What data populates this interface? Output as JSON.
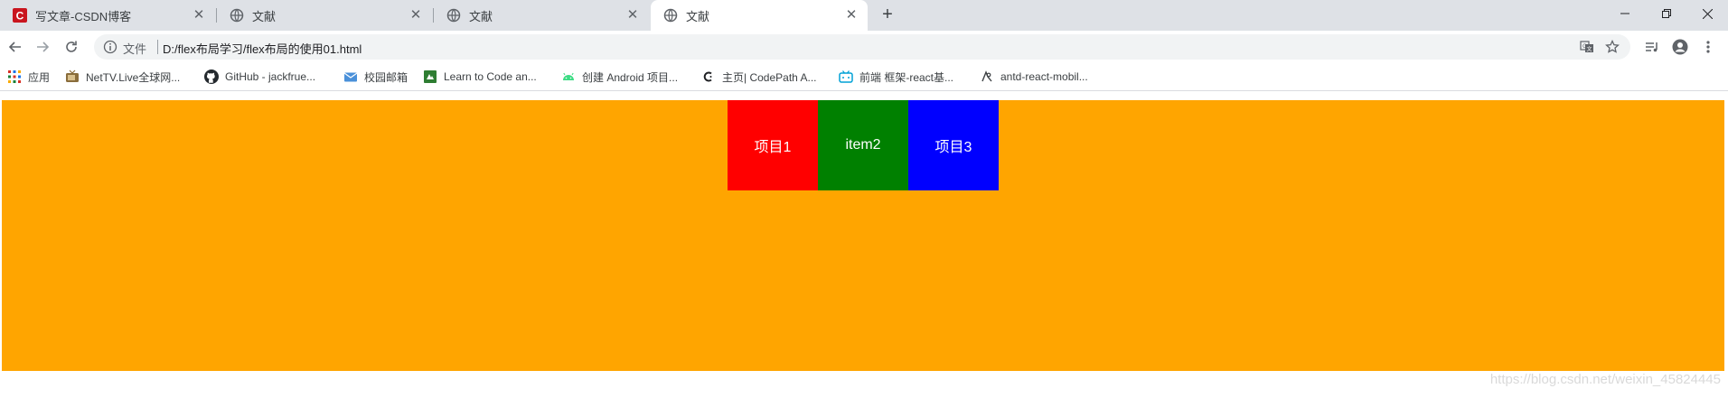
{
  "tabs": [
    {
      "title": "写文章-CSDN博客",
      "icon": "csdn-logo-icon",
      "active": false
    },
    {
      "title": "文献",
      "icon": "globe-icon",
      "active": false
    },
    {
      "title": "文献",
      "icon": "globe-icon",
      "active": false
    },
    {
      "title": "文献",
      "icon": "globe-icon",
      "active": true
    }
  ],
  "toolbar": {
    "scheme_label": "文件",
    "url": "D:/flex布局学习/flex布局的使用01.html"
  },
  "bookmarks": [
    {
      "label": "应用",
      "icon": "apps-grid-icon"
    },
    {
      "label": "NetTV.Live全球网...",
      "icon": "tv-icon"
    },
    {
      "label": "GitHub - jackfrue...",
      "icon": "github-icon"
    },
    {
      "label": "校园邮箱",
      "icon": "mail-icon"
    },
    {
      "label": "Learn to Code an...",
      "icon": "freecodecamp-icon"
    },
    {
      "label": "创建 Android 项目...",
      "icon": "android-icon"
    },
    {
      "label": "主页| CodePath A...",
      "icon": "codepath-icon"
    },
    {
      "label": "前端 框架-react基...",
      "icon": "bilibili-icon"
    },
    {
      "label": "antd-react-mobil...",
      "icon": "antd-icon"
    }
  ],
  "page": {
    "container_color": "#ffa500",
    "items": [
      {
        "label": "项目1",
        "color": "#ff0000"
      },
      {
        "label": "item2",
        "color": "#008000"
      },
      {
        "label": "项目3",
        "color": "#0000ff"
      }
    ]
  },
  "watermark": "https://blog.csdn.net/weixin_45824445"
}
